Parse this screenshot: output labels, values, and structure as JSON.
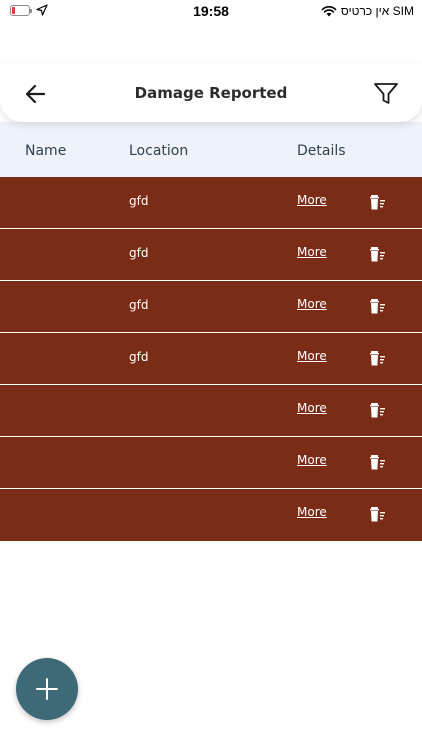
{
  "status_bar": {
    "time": "19:58",
    "carrier": "אין כרטיס SIM",
    "battery_color": "#e53935"
  },
  "header": {
    "title": "Damage Reported",
    "back_icon": "arrow-left-icon",
    "filter_icon": "filter-icon"
  },
  "table": {
    "columns": [
      "Name",
      "Location",
      "Details"
    ],
    "row_color": "#7a2c17",
    "rows": [
      {
        "name": "",
        "location": "gfd",
        "details": "More"
      },
      {
        "name": "",
        "location": "gfd",
        "details": "More"
      },
      {
        "name": "",
        "location": "gfd",
        "details": "More"
      },
      {
        "name": "",
        "location": "gfd",
        "details": "More"
      },
      {
        "name": "",
        "location": "",
        "details": "More"
      },
      {
        "name": "",
        "location": "",
        "details": "More"
      },
      {
        "name": "",
        "location": "",
        "details": "More"
      }
    ]
  },
  "fab": {
    "icon": "plus-icon",
    "color": "#3e6a78"
  }
}
